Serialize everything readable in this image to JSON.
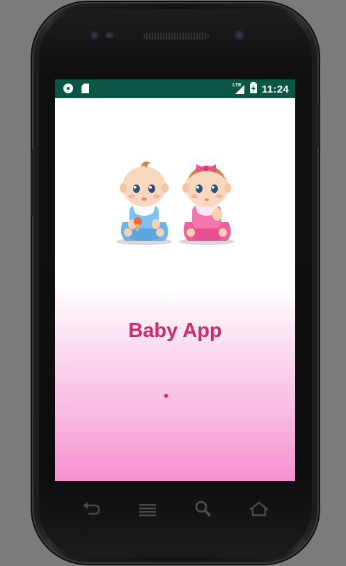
{
  "status_bar": {
    "icons_left": [
      "circle-notification-icon",
      "sd-card-icon"
    ],
    "network_label": "LTE",
    "time": "11:24"
  },
  "app": {
    "title": "Baby App"
  },
  "nav_bar": {
    "buttons": [
      "back",
      "menu",
      "search",
      "home"
    ]
  },
  "colors": {
    "status_bar": "#0b5545",
    "title": "#d12a67",
    "gradient_bottom": "#f78fd0"
  }
}
